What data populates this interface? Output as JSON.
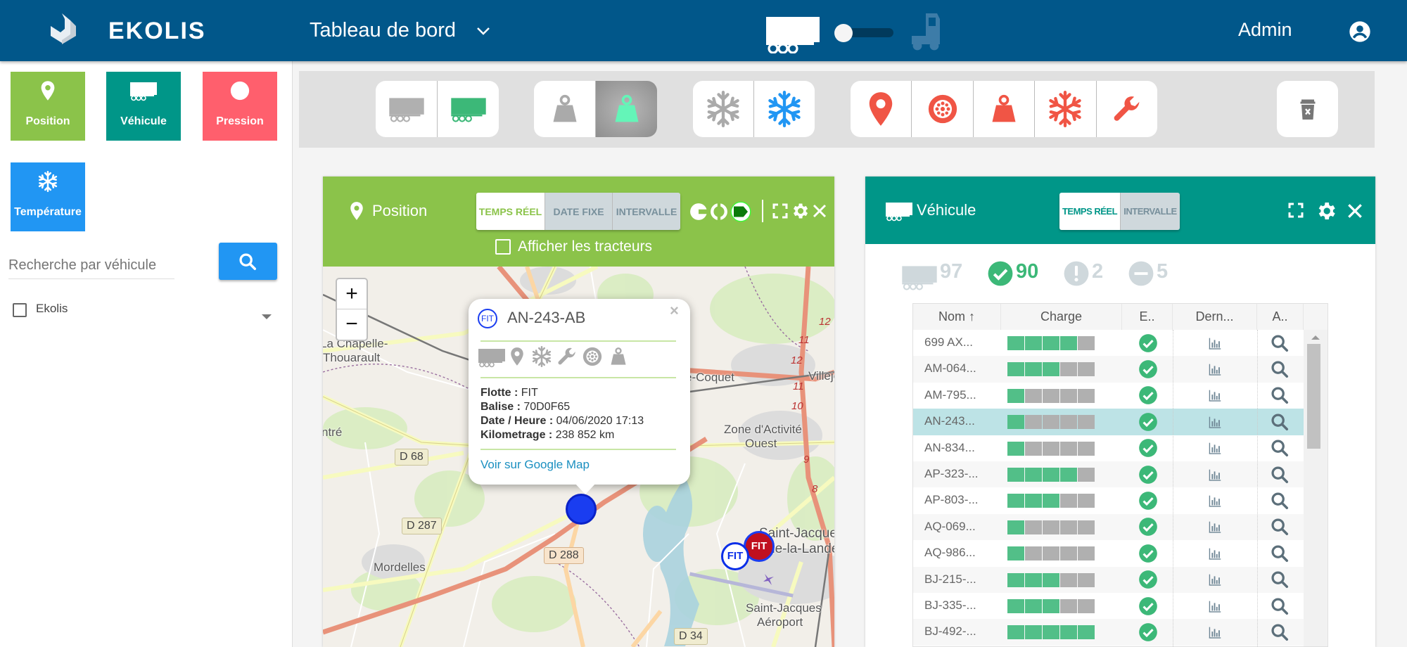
{
  "colors": {
    "header": "#01578a",
    "position": "#8bc34a",
    "vehicule": "#009688",
    "pression": "#ff5f6d",
    "temperature": "#2196f3",
    "alert": "#f05545",
    "charge_full": "#52bf88",
    "charge_empty": "#b0b0b0",
    "selected_row": "#bde3e6"
  },
  "header": {
    "logo": "EKOLIS",
    "title": "Tableau de bord",
    "user": "Admin",
    "mode_toggle": "trailer"
  },
  "sidebar": {
    "tiles": [
      {
        "label": "Position",
        "icon": "pin-icon"
      },
      {
        "label": "Véhicule",
        "icon": "trailer-icon"
      },
      {
        "label": "Pression",
        "icon": "tire-icon"
      },
      {
        "label": "Température",
        "icon": "snowflake-icon"
      }
    ],
    "search": {
      "placeholder": "Recherche par véhicule",
      "value": ""
    },
    "tree": [
      {
        "label": "Ekolis",
        "checked": false
      }
    ]
  },
  "toolbar": {
    "groups": [
      [
        "trailer-grey",
        "trailer-green"
      ],
      [
        "weight-grey",
        "weight-green"
      ],
      [
        "snowflake-grey",
        "snowflake-blue"
      ],
      [
        "pin-red",
        "tire-red",
        "weight-red",
        "snowflake-red",
        "wrench-red"
      ]
    ],
    "trash": "trash-icon"
  },
  "position_panel": {
    "title": "Position",
    "modes": [
      "TEMPS RÉEL",
      "DATE FIXE",
      "INTERVALLE"
    ],
    "active_mode": "TEMPS RÉEL",
    "show_tractors_label": "Afficher les tracteurs",
    "show_tractors": false,
    "map": {
      "zoom_in": "+",
      "zoom_out": "−",
      "labels": [
        "La Chapelle-",
        "Thouarault",
        "ntré",
        "Mordelles",
        "e-Coquet",
        "Villeje",
        "Zone d'Activité",
        "Ouest",
        "Saint-Jacques",
        "de-la-Lande",
        "Saint-Jacques",
        "Aéroport"
      ],
      "road_refs": [
        "D 68",
        "D 287",
        "D 288",
        "D 34"
      ],
      "exit_numbers": [
        "12",
        "11",
        "12",
        "11",
        "10",
        "9",
        "8"
      ],
      "markers": [
        {
          "label": "FIT",
          "color": "#0a2ee8"
        },
        {
          "label": "FIT",
          "color": "#0a2ee8"
        },
        {
          "label": "FIT",
          "color": "#c0101f"
        }
      ],
      "popup": {
        "fleet_badge": "FIT",
        "plate": "AN-243-AB",
        "fields": [
          {
            "label": "Flotte :",
            "value": "FIT"
          },
          {
            "label": "Balise :",
            "value": "70D0F65"
          },
          {
            "label": "Date / Heure :",
            "value": "04/06/2020 17:13"
          },
          {
            "label": "Kilometrage :",
            "value": "238 852 km"
          }
        ],
        "link": "Voir sur Google Map"
      }
    }
  },
  "vehicle_panel": {
    "title": "Véhicule",
    "modes": [
      "TEMPS RÉEL",
      "INTERVALLE"
    ],
    "active_mode": "TEMPS RÉEL",
    "stats": {
      "total": "97",
      "ok": "90",
      "warning": "2",
      "inactive": "5"
    },
    "columns": [
      "Nom ↑",
      "Charge",
      "E..",
      "Dern...",
      "A.."
    ],
    "rows": [
      {
        "name": "699 AX...",
        "charge": 4
      },
      {
        "name": "AM-064...",
        "charge": 3
      },
      {
        "name": "AM-795...",
        "charge": 1
      },
      {
        "name": "AN-243...",
        "charge": 1,
        "selected": true
      },
      {
        "name": "AN-834...",
        "charge": 1
      },
      {
        "name": "AP-323-...",
        "charge": 4
      },
      {
        "name": "AP-803-...",
        "charge": 3
      },
      {
        "name": "AQ-069...",
        "charge": 1
      },
      {
        "name": "AQ-986...",
        "charge": 1
      },
      {
        "name": "BJ-215-...",
        "charge": 3
      },
      {
        "name": "BJ-335-...",
        "charge": 3
      },
      {
        "name": "BJ-492-...",
        "charge": 5
      }
    ],
    "charge_max": 5
  }
}
